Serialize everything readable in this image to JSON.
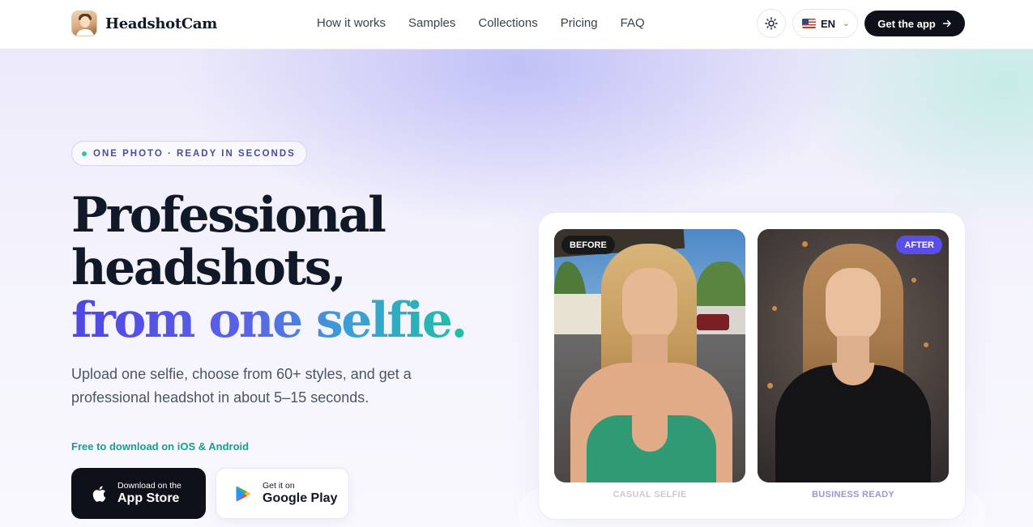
{
  "brand": {
    "name": "HeadshotCam"
  },
  "nav": {
    "items": [
      "How it works",
      "Samples",
      "Collections",
      "Pricing",
      "FAQ"
    ]
  },
  "header": {
    "language": "EN",
    "cta_label": "Get the app"
  },
  "hero": {
    "badge": "ONE PHOTO · READY IN SECONDS",
    "headline_line1": "Professional",
    "headline_line2": "headshots,",
    "headline_line3": "from one selfie.",
    "subtitle": "Upload one selfie, choose from 60+ styles, and get a professional headshot in about 5–15 seconds.",
    "free_text": "Free to download on iOS & Android",
    "app_store": {
      "small": "Download on the",
      "big": "App Store"
    },
    "google_play": {
      "small": "Get it on",
      "big": "Google Play"
    }
  },
  "comparison": {
    "before_tag": "BEFORE",
    "after_tag": "AFTER",
    "before_caption": "CASUAL SELFIE",
    "after_caption": "BUSINESS READY"
  },
  "icons": {
    "theme": "sun-icon",
    "language": "us-flag-icon",
    "cta": "arrow-right-icon",
    "app_store": "apple-icon",
    "google_play": "google-play-icon"
  },
  "colors": {
    "brand_dark": "#0f111a",
    "accent_indigo": "#4f46e5",
    "accent_teal": "#14a08a",
    "after_tag": "#5b4ee6"
  }
}
